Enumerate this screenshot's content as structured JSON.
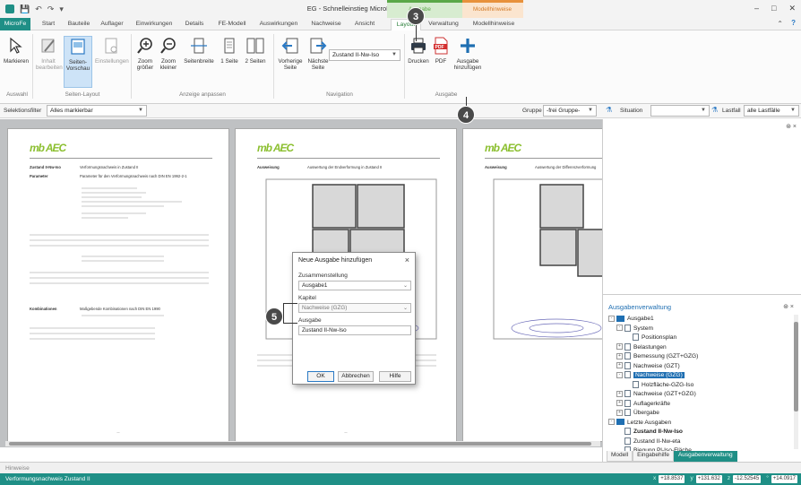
{
  "app": {
    "title": "EG - Schnelleinstieg MicroFe - Plattentragwerk - MicroFe 2022",
    "context_groups": [
      {
        "label": "Ausgabe",
        "color": "#5aa848"
      },
      {
        "label": "Modellhinweise",
        "color": "#e8913c"
      }
    ]
  },
  "tabs": [
    "MicroFe",
    "Start",
    "Bauteile",
    "Auflager",
    "Einwirkungen",
    "Details",
    "FE-Modell",
    "Auswirkungen",
    "Nachweise",
    "Ansicht",
    "Layout",
    "Verwaltung",
    "Modellhinweise"
  ],
  "active_tab": "Layout",
  "ribbon": {
    "groups": {
      "auswahl": "Auswahl",
      "seiten_layout": "Seiten-Layout",
      "anzeige": "Anzeige anpassen",
      "navigation": "Navigation",
      "ausgabe": "Ausgabe"
    },
    "buttons": {
      "markieren": "Markieren",
      "inhalt": "Inhalt bearbeiten",
      "seitenvorschau": "Seiten-Vorschau",
      "einstellungen": "Einstellungen",
      "zoom_groesser": "Zoom größer",
      "zoom_kleiner": "Zoom kleiner",
      "seitenbreite": "Seitenbreite",
      "eine_seite": "1 Seite",
      "zwei_seiten": "2 Seiten",
      "vorherige": "Vorherige Seite",
      "naechste": "Nächste Seite",
      "drucken": "Drucken",
      "pdf": "PDF",
      "ausgabe_hinzufuegen": "Ausgabe hinzufügen"
    },
    "nav_select": "Zustand II-Nw-Iso"
  },
  "filterbar": {
    "selektionsfilter_label": "Selektionsfilter",
    "selektionsfilter_value": "Alles markierbar",
    "gruppe_label": "Gruppe",
    "gruppe_value": "-frei Gruppe-",
    "situation_label": "Situation",
    "lastfall_label": "Lastfall",
    "lastfall_value": "alle Lastfälle"
  },
  "pages": [
    {
      "logo": "mb AEC",
      "heading": "Zustand II-Nw-Iso",
      "subheading": "Verformungsnachweis in Zustand II",
      "parameter_label": "Parameter",
      "parameter_text": "Parameter für den Verformungsnachweis nach DIN EN 1992-2-1",
      "komb_label": "Kombinationen",
      "komb_text": "Maßgebende Kombinationen nach DIN EN 1990"
    },
    {
      "logo": "mb AEC",
      "heading": "Ausweisung",
      "subheading": "Auswertung der Endverformung in Zustand II"
    },
    {
      "logo": "mb AEC",
      "heading": "Ausweisung",
      "subheading": "Auswertung der Differenzverformung"
    }
  ],
  "dialog": {
    "title": "Neue Ausgabe hinzufügen",
    "zusammenstellung_label": "Zusammenstellung",
    "zusammenstellung_value": "Ausgabe1",
    "kapitel_label": "Kapitel",
    "kapitel_value": "Nachweise (GZG)",
    "ausgabe_label": "Ausgabe",
    "ausgabe_value": "Zustand II-Nw-Iso",
    "ok": "OK",
    "abbrechen": "Abbrechen",
    "hilfe": "Hilfe"
  },
  "ausgabenverwaltung": {
    "title": "Ausgabenverwaltung",
    "tree": [
      {
        "label": "Ausgabe1",
        "level": 0,
        "type": "folder",
        "exp": "-"
      },
      {
        "label": "System",
        "level": 1,
        "type": "doc",
        "exp": "-"
      },
      {
        "label": "Positionsplan",
        "level": 2,
        "type": "doc",
        "exp": ""
      },
      {
        "label": "Belastungen",
        "level": 1,
        "type": "doc",
        "exp": "+"
      },
      {
        "label": "Bemessung (GZT+GZG)",
        "level": 1,
        "type": "doc",
        "exp": "+"
      },
      {
        "label": "Nachweise (GZT)",
        "level": 1,
        "type": "doc",
        "exp": "+"
      },
      {
        "label": "Nachweise (GZG)",
        "level": 1,
        "type": "doc",
        "exp": "-",
        "highlight": true
      },
      {
        "label": "Holzfläche-GZG-Iso",
        "level": 2,
        "type": "doc",
        "exp": ""
      },
      {
        "label": "Nachweise (GZT+GZG)",
        "level": 1,
        "type": "doc",
        "exp": "+"
      },
      {
        "label": "Auflagerkräfte",
        "level": 1,
        "type": "doc",
        "exp": "+"
      },
      {
        "label": "Übergabe",
        "level": 1,
        "type": "doc",
        "exp": "+"
      },
      {
        "label": "Letzte Ausgaben",
        "level": 0,
        "type": "folder",
        "exp": "-"
      },
      {
        "label": "Zustand II-Nw-Iso",
        "level": 1,
        "type": "doc",
        "exp": "",
        "bold": true
      },
      {
        "label": "Zustand II-Nw-eta",
        "level": 1,
        "type": "doc",
        "exp": ""
      },
      {
        "label": "Biegung Pl-Iso-Fläche",
        "level": 1,
        "type": "doc",
        "exp": ""
      }
    ],
    "bottom_tabs": [
      "Modell",
      "Eingabehilfe",
      "Ausgabenverwaltung"
    ],
    "active_bottom_tab": "Ausgabenverwaltung"
  },
  "hinweise_tab": "Hinweise",
  "status": {
    "text": "Verformungsnachweis Zustand II",
    "x_label": "x",
    "x": "+18.8537",
    "y_label": "y",
    "y": "+131.632",
    "z_label": "z",
    "z": "-12.52545",
    "w_label": "°",
    "w": "+14.0917"
  },
  "badges": [
    "3",
    "4",
    "5"
  ]
}
